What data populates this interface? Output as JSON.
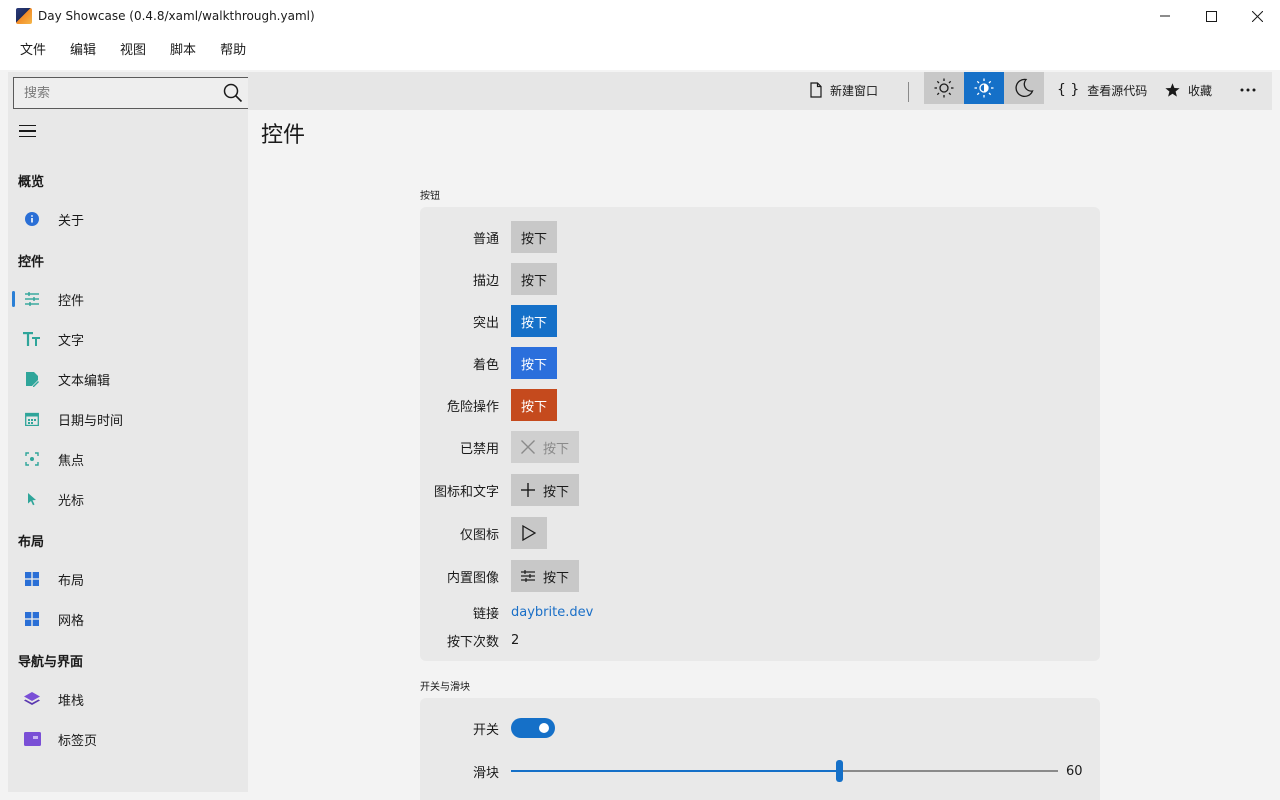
{
  "window": {
    "title": "Day Showcase (0.4.8/xaml/walkthrough.yaml)"
  },
  "menu": [
    "文件",
    "编辑",
    "视图",
    "脚本",
    "帮助"
  ],
  "search": {
    "placeholder": "搜索"
  },
  "sidebar": {
    "sections": [
      {
        "header": "概览",
        "items": [
          {
            "label": "关于",
            "icon": "info-icon",
            "color": "#2a6fd6"
          }
        ]
      },
      {
        "header": "控件",
        "items": [
          {
            "label": "控件",
            "icon": "sliders-icon",
            "color": "#2fa59a",
            "active": true
          },
          {
            "label": "文字",
            "icon": "text-size-icon",
            "color": "#2fa59a"
          },
          {
            "label": "文本编辑",
            "icon": "edit-document-icon",
            "color": "#2fa59a"
          },
          {
            "label": "日期与时间",
            "icon": "calendar-icon",
            "color": "#2fa59a"
          },
          {
            "label": "焦点",
            "icon": "focus-icon",
            "color": "#2fa59a"
          },
          {
            "label": "光标",
            "icon": "cursor-icon",
            "color": "#2fa59a"
          }
        ]
      },
      {
        "header": "布局",
        "items": [
          {
            "label": "布局",
            "icon": "layout-icon",
            "color": "#2a6fd6"
          },
          {
            "label": "网格",
            "icon": "grid-icon",
            "color": "#2a6fd6"
          }
        ]
      },
      {
        "header": "导航与界面",
        "items": [
          {
            "label": "堆栈",
            "icon": "stack-icon",
            "color": "#7a4fd6"
          },
          {
            "label": "标签页",
            "icon": "tab-icon",
            "color": "#7a4fd6"
          }
        ]
      }
    ]
  },
  "toolbar": {
    "new_window": "新建窗口",
    "view_source": "查看源代码",
    "favorite": "收藏",
    "theme_active": "high-contrast-light",
    "accent_color": "#1570c8"
  },
  "page": {
    "title": "控件",
    "buttons_section": {
      "label": "按钮",
      "rows": [
        {
          "label": "普通",
          "button": "按下",
          "style": "plain"
        },
        {
          "label": "描边",
          "button": "按下",
          "style": "plain"
        },
        {
          "label": "突出",
          "button": "按下",
          "style": "accent"
        },
        {
          "label": "着色",
          "button": "按下",
          "style": "tint"
        },
        {
          "label": "危险操作",
          "button": "按下",
          "style": "danger"
        },
        {
          "label": "已禁用",
          "button": "按下",
          "style": "disabled",
          "icon": "close-icon"
        },
        {
          "label": "图标和文字",
          "button": "按下",
          "style": "plain",
          "icon": "plus-icon"
        },
        {
          "label": "仅图标",
          "button": "",
          "style": "plain",
          "icon": "play-icon"
        },
        {
          "label": "内置图像",
          "button": "按下",
          "style": "plain",
          "icon": "sliders-icon"
        }
      ],
      "link_label": "链接",
      "link_text": "daybrite.dev",
      "count_label": "按下次数",
      "count_value": "2"
    },
    "switches_section": {
      "label": "开关与滑块",
      "switch_label": "开关",
      "switch_on": true,
      "slider_label": "滑块",
      "slider_value": "60",
      "slider_fraction": 0.6
    }
  }
}
